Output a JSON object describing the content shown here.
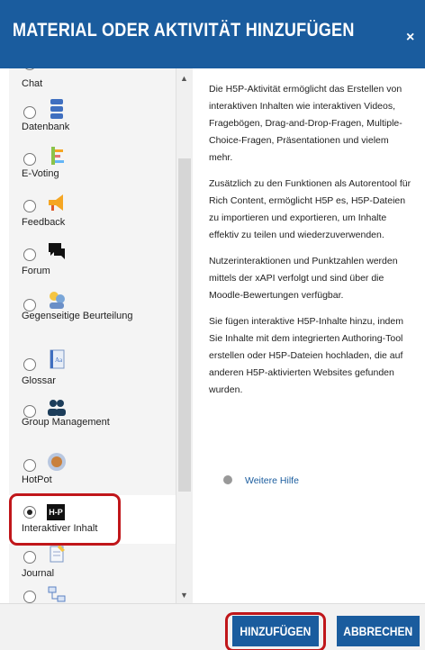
{
  "dialog": {
    "title": "MATERIAL ODER AKTIVITÄT HINZUFÜGEN",
    "close_glyph": "×"
  },
  "modules": [
    {
      "label": "Chat",
      "icon": "chat-icon",
      "selected": false
    },
    {
      "label": "Datenbank",
      "icon": "database-icon",
      "selected": false
    },
    {
      "label": "E-Voting",
      "icon": "bar-chart-icon",
      "selected": false
    },
    {
      "label": "Feedback",
      "icon": "megaphone-icon",
      "selected": false
    },
    {
      "label": "Forum",
      "icon": "speech-bubbles-icon",
      "selected": false
    },
    {
      "label": "Gegenseitige Beurteilung",
      "icon": "peer-review-icon",
      "selected": false
    },
    {
      "label": "Glossar",
      "icon": "glossary-book-icon",
      "selected": false
    },
    {
      "label": "Group Management",
      "icon": "group-icon",
      "selected": false
    },
    {
      "label": "HotPot",
      "icon": "hotpot-icon",
      "selected": false
    },
    {
      "label": "Interaktiver Inhalt",
      "icon": "h5p-icon",
      "icon_text": "H-P",
      "selected": true
    },
    {
      "label": "Journal",
      "icon": "journal-icon",
      "selected": false
    },
    {
      "label": "",
      "icon": "lesson-flowchart-icon",
      "selected": false
    }
  ],
  "description": [
    "Die H5P-Aktivität ermöglicht das Erstellen von interaktiven Inhalten wie interaktiven Videos, Fragebögen, Drag-and-Drop-Fragen, Multiple-Choice-Fragen, Präsentationen und vielem mehr.",
    "Zusätzlich zu den Funktionen als Autorentool für Rich Content, ermöglicht H5P es, H5P-Dateien zu importieren und exportieren, um Inhalte effektiv zu teilen und wiederzuverwenden.",
    "Nutzerinteraktionen und Punktzahlen werden mittels der xAPI verfolgt und sind über die Moodle-Bewertungen verfügbar.",
    "Sie fügen interaktive H5P-Inhalte hinzu, indem Sie Inhalte mit dem integrierten Authoring-Tool erstellen oder H5P-Dateien hochladen, die auf anderen H5P-aktivierten Websites gefunden wurden."
  ],
  "help_link": "Weitere Hilfe",
  "buttons": {
    "add": "HINZUFÜGEN",
    "cancel": "ABBRECHEN"
  },
  "colors": {
    "header": "#1a5c9e",
    "button": "#1a5c9e",
    "highlight": "#c0161a"
  }
}
